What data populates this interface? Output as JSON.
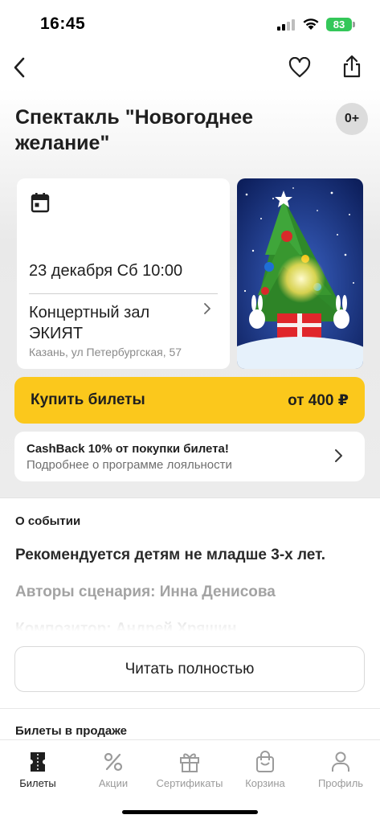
{
  "status_bar": {
    "time": "16:45",
    "battery": "83"
  },
  "event": {
    "title": "Спектакль \"Новогоднее желание\"",
    "age_rating": "0+",
    "date_time": "23 декабря Сб 10:00",
    "venue_name": "Концертный зал ЭКИЯТ",
    "venue_address": "Казань, ул Петербургская, 57"
  },
  "buy": {
    "label": "Купить билеты",
    "price": "от 400 ₽"
  },
  "cashback": {
    "title": "CashBack 10% от покупки билета!",
    "subtitle": "Подробнее о программе лояльности"
  },
  "about": {
    "heading": "О событии",
    "lines": [
      "Рекомендуется детям не младше 3-х лет.",
      "Авторы сценария: Инна Денисова",
      "Композитор: Андрей Хрящин"
    ],
    "read_more": "Читать полностью"
  },
  "tickets_heading": "Билеты в продаже",
  "tabs": [
    {
      "label": "Билеты",
      "icon": "ticket-icon",
      "active": true
    },
    {
      "label": "Акции",
      "icon": "percent-icon",
      "active": false
    },
    {
      "label": "Сертификаты",
      "icon": "gift-icon",
      "active": false
    },
    {
      "label": "Корзина",
      "icon": "basket-icon",
      "active": false
    },
    {
      "label": "Профиль",
      "icon": "profile-icon",
      "active": false
    }
  ],
  "colors": {
    "accent": "#fbc81c",
    "battery": "#34c759"
  }
}
